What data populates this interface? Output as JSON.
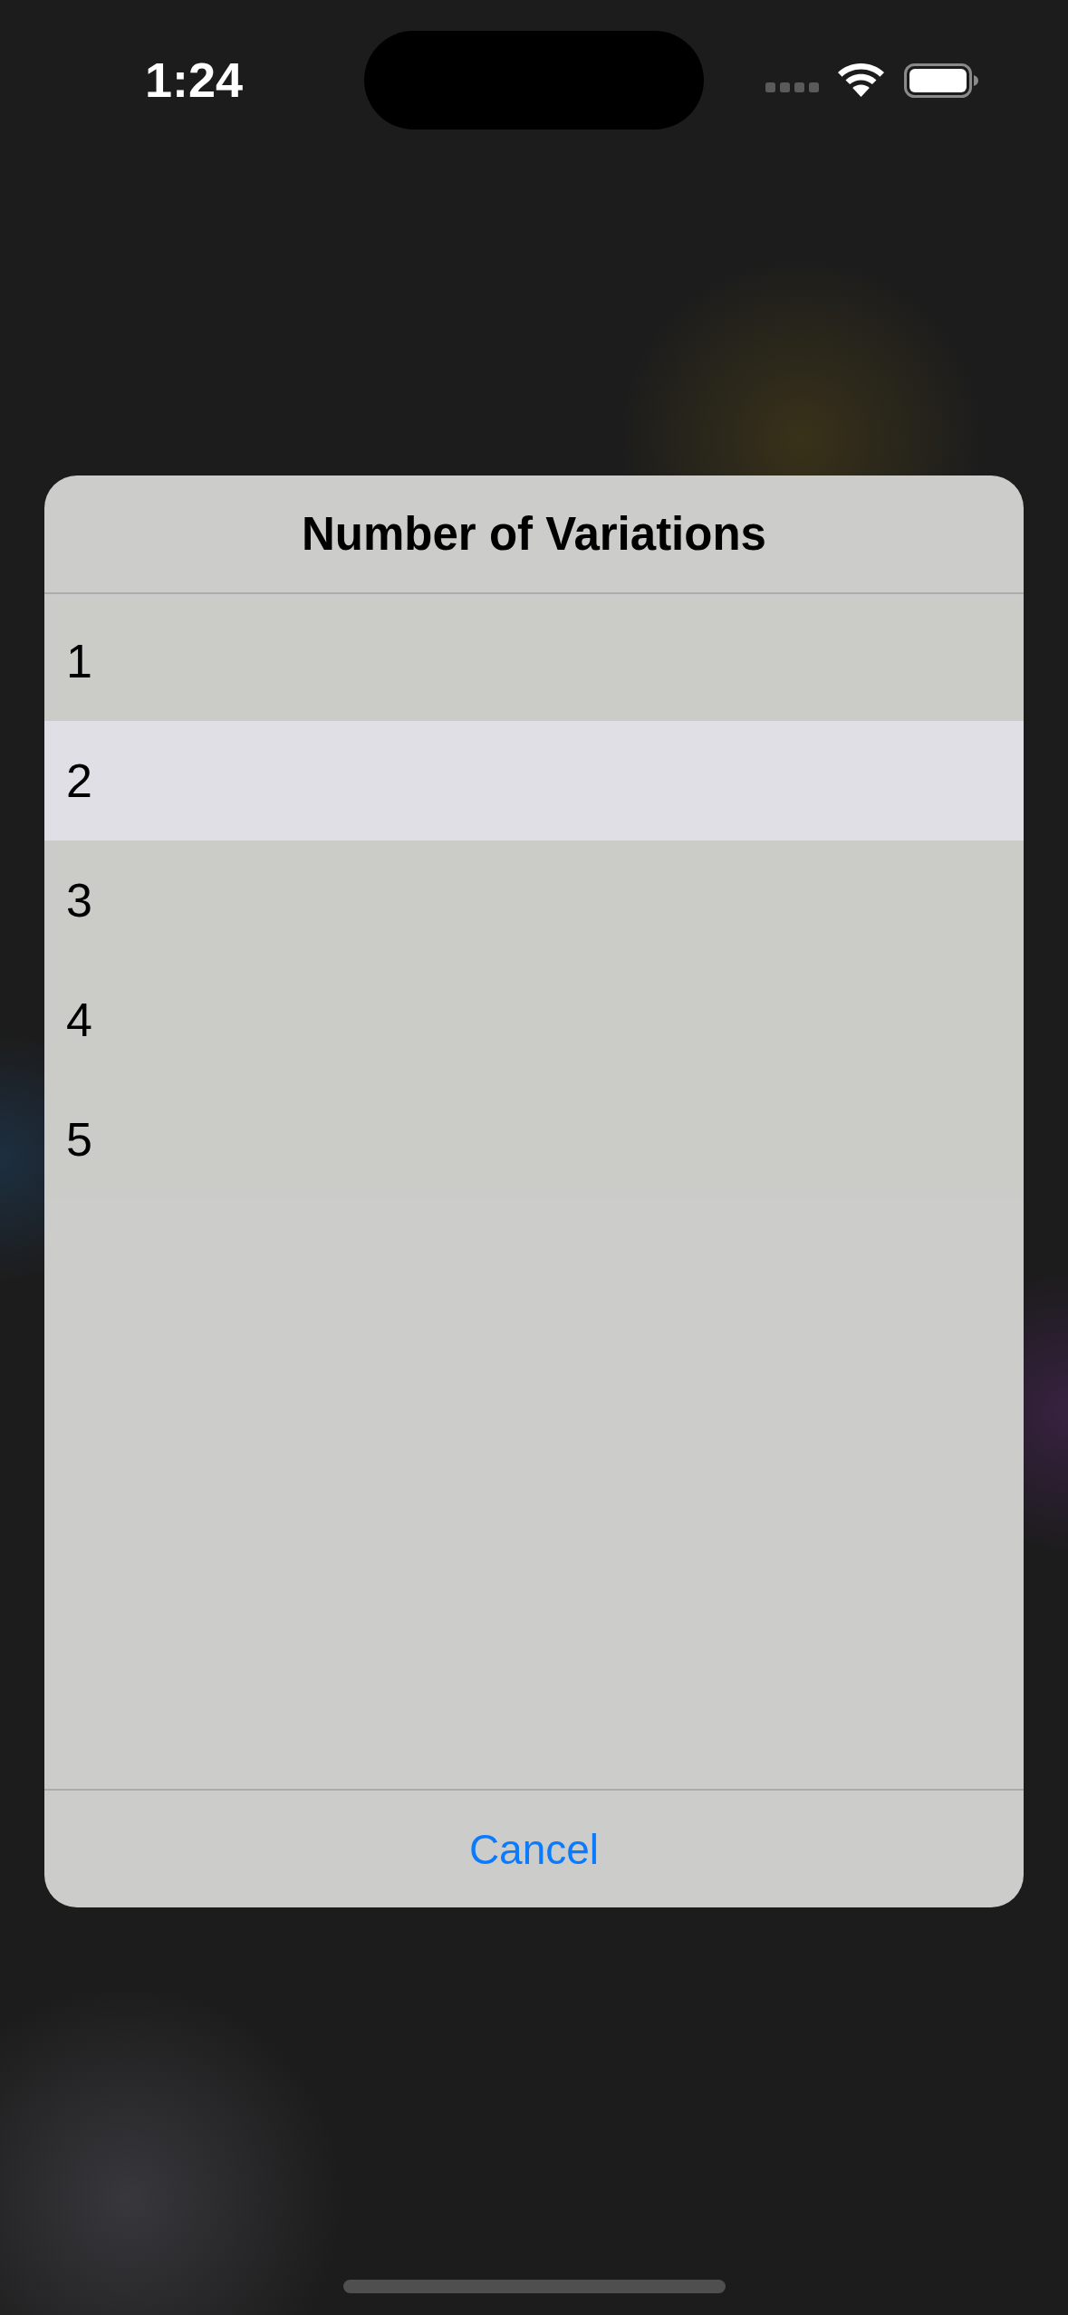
{
  "status_bar": {
    "time": "1:24"
  },
  "dialog": {
    "title": "Number of Variations",
    "options": [
      {
        "label": "1",
        "selected": false
      },
      {
        "label": "2",
        "selected": true
      },
      {
        "label": "3",
        "selected": false
      },
      {
        "label": "4",
        "selected": false
      },
      {
        "label": "5",
        "selected": false
      }
    ],
    "cancel": "Cancel"
  }
}
